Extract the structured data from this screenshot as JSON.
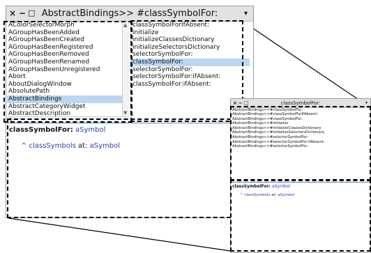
{
  "main_window": {
    "title": "AbstractBindings>> #classSymbolFor:",
    "close_glyph": "×",
    "minimize_glyph": "−",
    "maximize_glyph": "□",
    "menu_glyph": "▾",
    "class_list": {
      "items": [
        "AColorSelectorMorph",
        "AGroupHasBeenAdded",
        "AGroupHasBeenCreated",
        "AGroupHasBeenRegistered",
        "AGroupHasBeenRemoved",
        "AGroupHasBeenRenamed",
        "AGroupHasBeenUnregistered",
        "Abort",
        "AboutDialogWindow",
        "AbsolutePath",
        "AbstractBindings",
        "AbstractCategoryWidget",
        "AbstractDescription"
      ],
      "selected": "AbstractBindings"
    },
    "method_list": {
      "items": [
        "classSymbolForIfAbsent:",
        "initialize",
        "initializeClassesDictionary",
        "initializeSelectorsDictionary",
        "selectorSymbolFor:",
        "classSymbolFor:",
        "selectorSymbolFor:",
        "selectorSymbolFor:ifAbsent:",
        "classSymbolFor:ifAbsent:"
      ],
      "selected": "classSymbolFor:"
    },
    "code": {
      "selector": "classSymbolFor:",
      "argument": "aSymbol",
      "body_prefix": "^ classSymbols",
      "body_keyword": "at:",
      "body_argument": "aSymbol"
    }
  },
  "zoom_window": {
    "title": "classSymbolFor:",
    "close_glyph": "×",
    "minimize_glyph": "−",
    "maximize_glyph": "□",
    "menu_glyph": "▾",
    "overlapped_line": "AbstractBindings>>#classSymbolFor:",
    "list_items": [
      "AbstractBindings>>#classSymbolForIfAbsent:",
      "AbstractBindings>>#classSymbolFor:",
      "AbstractBindings>>#initialize",
      "AbstractBindings>>#initializeClassesDictionary",
      "AbstractBindings>>#initializeSelectorsDictionary",
      "AbstractBindings>>#selectorSymbolFor:",
      "AbstractBindings>>#selectorSymbolFor:ifAbsent:",
      "AbstractBindings>>#selectorSymbolFor:"
    ],
    "code": {
      "selector": "classSymbolFor:",
      "argument": "aSymbol",
      "body_prefix": "^ classSymbols",
      "body_keyword": "at:",
      "body_argument": "aSymbol"
    }
  },
  "colors": {
    "selection": "#b9d7f3",
    "argument_blue": "#2c3ea8",
    "titlebar": "#e2e2e2"
  }
}
